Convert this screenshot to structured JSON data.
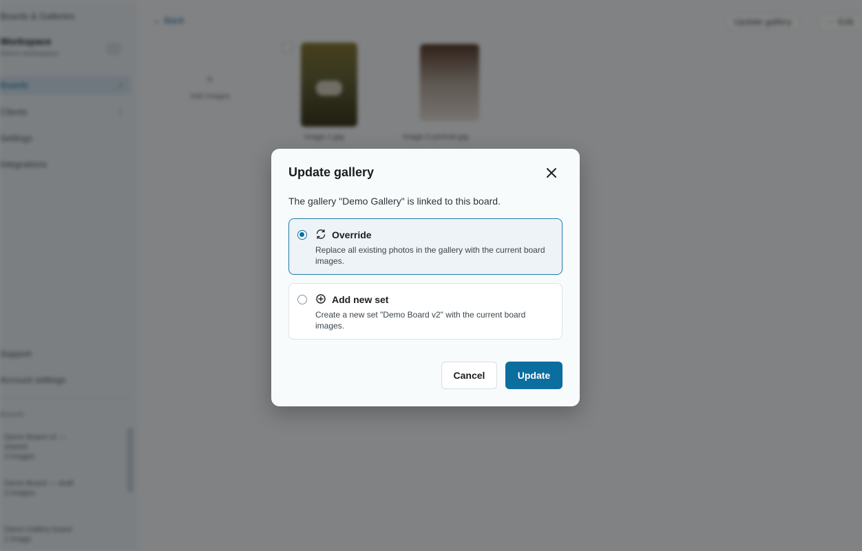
{
  "background": {
    "sidebar": {
      "brand": "Boards & Galleries",
      "workspace_name": "Workspace",
      "workspace_sub": "Demo workspace",
      "items": [
        {
          "label": "Boards",
          "count": "2",
          "active": true
        },
        {
          "label": "Clients",
          "count": "1"
        },
        {
          "label": "Settings"
        },
        {
          "label": "Integrations"
        }
      ],
      "bottom_items": [
        {
          "label": "Support"
        },
        {
          "label": "Account settings"
        }
      ],
      "section_label": "Boards",
      "boards": [
        {
          "line1": "Demo Board v2 — shared",
          "line2": "3 images"
        },
        {
          "line1": "Demo Board — draft",
          "line2": "2 images"
        },
        {
          "line1": "Demo Gallery board",
          "line2": "1 image"
        }
      ]
    },
    "main": {
      "back_label": "← Back",
      "actions": [
        "Update gallery",
        "⋯ Edit"
      ],
      "add_tile_label": "Add images",
      "thumb_captions": [
        "image-1.jpg",
        "image-2-portrait.jpg"
      ]
    }
  },
  "modal": {
    "title": "Update gallery",
    "description": "The gallery \"Demo Gallery\" is linked to this board.",
    "options": [
      {
        "icon": "refresh-icon",
        "label": "Override",
        "description": "Replace all existing photos in the gallery with the current board images.",
        "selected": true
      },
      {
        "icon": "plus-circle-icon",
        "label": "Add new set",
        "description": "Create a new set \"Demo Board v2\" with the current board images.",
        "selected": false
      }
    ],
    "cancel_label": "Cancel",
    "confirm_label": "Update"
  },
  "colors": {
    "accent": "#0b6e9f",
    "selected_border": "#1f7aa5",
    "selected_bg": "#edf3f7",
    "overlay": "rgba(0,0,0,0.48)"
  }
}
